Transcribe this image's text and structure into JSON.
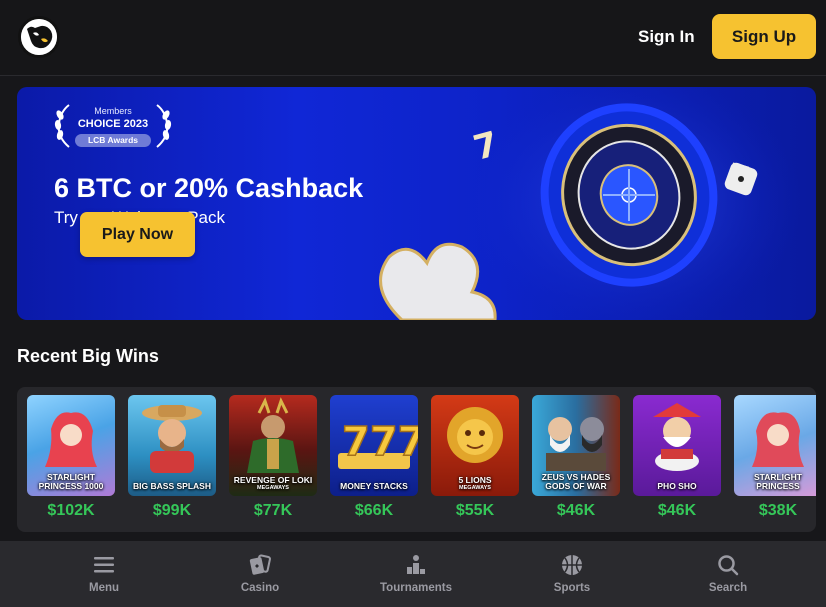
{
  "header": {
    "signin_label": "Sign In",
    "signup_label": "Sign Up"
  },
  "banner": {
    "award_top": "Members",
    "award_mid": "CHOICE 2023",
    "award_pill": "LCB Awards",
    "title": "6 BTC or 20% Cashback",
    "subtitle": "Try our Welcome Pack",
    "play_label": "Play Now"
  },
  "recent_wins": {
    "title": "Recent Big Wins",
    "games": [
      {
        "name": "STARLIGHT PRINCESS 1000",
        "sub": "",
        "amount": "$102K"
      },
      {
        "name": "BIG BASS SPLASH",
        "sub": "",
        "amount": "$99K"
      },
      {
        "name": "REVENGE OF LOKI",
        "sub": "MEGAWAYS",
        "amount": "$77K"
      },
      {
        "name": "MONEY STACKS",
        "sub": "",
        "amount": "$66K"
      },
      {
        "name": "5 LIONS",
        "sub": "MEGAWAYS",
        "amount": "$55K"
      },
      {
        "name": "ZEUS VS HADES GODS OF WAR",
        "sub": "",
        "amount": "$46K"
      },
      {
        "name": "PHO SHO",
        "sub": "",
        "amount": "$46K"
      },
      {
        "name": "STARLIGHT PRINCESS",
        "sub": "",
        "amount": "$38K"
      }
    ]
  },
  "bottom_nav": {
    "items": [
      {
        "label": "Menu",
        "icon": "menu-icon"
      },
      {
        "label": "Casino",
        "icon": "cards-icon"
      },
      {
        "label": "Tournaments",
        "icon": "podium-icon"
      },
      {
        "label": "Sports",
        "icon": "basketball-icon"
      },
      {
        "label": "Search",
        "icon": "search-icon"
      }
    ]
  },
  "colors": {
    "accent": "#f6c230",
    "win_green": "#35c759",
    "background": "#17171a",
    "banner_blue": "#1027d6"
  }
}
